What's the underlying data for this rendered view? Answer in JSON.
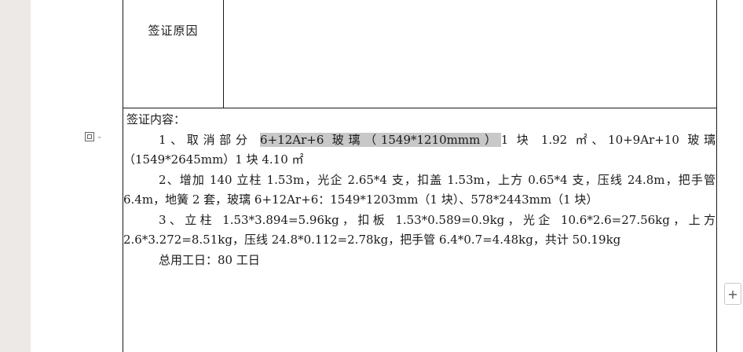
{
  "table": {
    "label_cell": "签证原因",
    "content": {
      "heading": "签证内容：",
      "item1_prefix": "1、取消部分 ",
      "item1_highlight": "6+12Ar+6 玻璃（1549*1210mmm）",
      "item1_rest": "1 块 1.92 ㎡、10+9Ar+10 玻璃（1549*2645mm）1 块 4.10 ㎡",
      "item2": "2、增加 140 立柱 1.53m，光企 2.65*4 支，扣盖 1.53m，上方 0.65*4 支，压线 24.8m，把手管 6.4m，地簧 2 套，玻璃 6+12Ar+6：1549*1203mm（1 块）、578*2443mm（1 块）",
      "item3": "3、立柱 1.53*3.894=5.96kg，扣板 1.53*0.589=0.9kg，光企 10.6*2.6=27.56kg，上方 2.6*3.272=8.51kg，压线 24.8*0.112=2.78kg，把手管 6.4*0.7=4.48kg，共计 50.19kg",
      "total": "总用工日：80 工日"
    }
  },
  "controls": {
    "block_handle_icon": "paragraph-handle-icon",
    "add_button_label": "+"
  }
}
